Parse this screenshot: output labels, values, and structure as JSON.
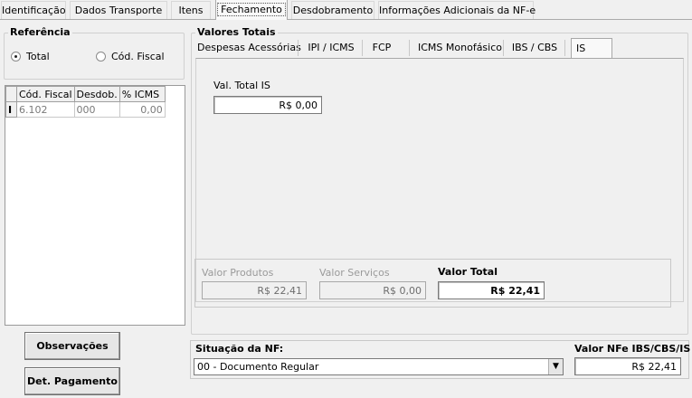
{
  "tabs": [
    {
      "label": "Identificação"
    },
    {
      "label": "Dados Transporte"
    },
    {
      "label": "Itens"
    },
    {
      "label": "Fechamento"
    },
    {
      "label": "Desdobramento"
    },
    {
      "label": "Informações Adicionais da NF-e"
    }
  ],
  "active_tab": "Fechamento",
  "referencia": {
    "title": "Referência",
    "option_total": "Total",
    "option_cod_fiscal": "Cód. Fiscal",
    "selected": "Total"
  },
  "grid": {
    "columns": [
      "Cód. Fiscal",
      "Desdob.",
      "% ICMS"
    ],
    "rows": [
      {
        "cod_fiscal": "6.102",
        "desdob": "000",
        "icms": "0,00"
      }
    ]
  },
  "valores_totais": {
    "title": "Valores Totais",
    "tabs": [
      "Despesas Acessórias",
      "IPI / ICMS",
      "FCP",
      "ICMS Monofásico",
      "IBS / CBS",
      "IS"
    ],
    "active_tab": "IS",
    "val_total_is_label": "Val. Total IS",
    "val_total_is_value": "R$ 0,00"
  },
  "totals": {
    "valor_produtos_label": "Valor Produtos",
    "valor_produtos": "R$ 22,41",
    "valor_servicos_label": "Valor Serviços",
    "valor_servicos": "R$ 0,00",
    "valor_total_label": "Valor Total",
    "valor_total": "R$ 22,41"
  },
  "buttons": {
    "observacoes": "Observações",
    "det_pagamento": "Det. Pagamento"
  },
  "situacao": {
    "label": "Situação da NF:",
    "value": "00 - Documento Regular"
  },
  "valor_nfe": {
    "label": "Valor NFe IBS/CBS/IS",
    "value": "R$ 22,41"
  }
}
